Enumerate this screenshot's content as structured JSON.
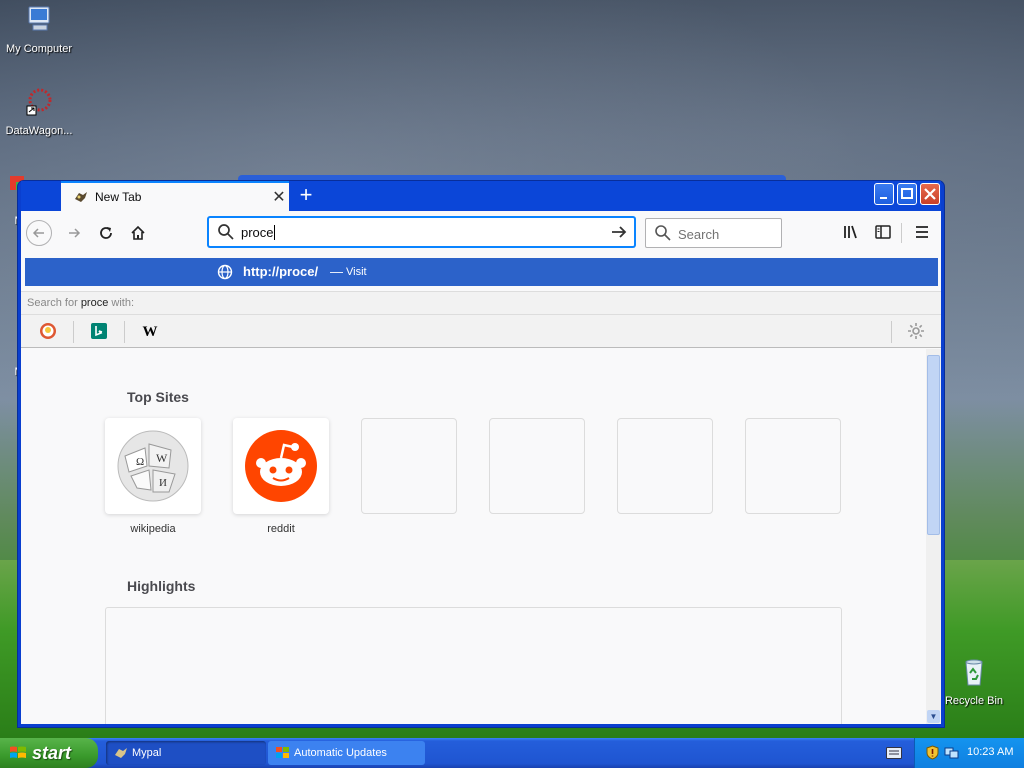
{
  "desktop": {
    "icons": [
      {
        "label": "My Computer"
      },
      {
        "label": "DataWagon..."
      },
      {
        "label": "Mic"
      },
      {
        "label": "Mic"
      },
      {
        "label": "Recycle Bin"
      }
    ]
  },
  "browser": {
    "tab": {
      "title": "New Tab",
      "close": "✕"
    },
    "new_tab_symbol": "+",
    "caption": {
      "minimize": "_",
      "maximize": "□",
      "close": "✕"
    },
    "urlbar": {
      "value": "proce"
    },
    "searchbar": {
      "placeholder": "Search"
    },
    "suggestion": {
      "url": "http://proce/",
      "dash": "—",
      "action": "Visit"
    },
    "oneoff": {
      "prefix": "Search for",
      "term": "proce",
      "suffix": "with:"
    },
    "engines": [
      {
        "name": "DuckDuckGo",
        "icon": "duckduckgo-icon"
      },
      {
        "name": "Bing",
        "icon": "bing-icon"
      },
      {
        "name": "Wikipedia",
        "icon": "wikipedia-icon",
        "glyph": "W"
      }
    ],
    "newtab": {
      "top_sites_title": "Top Sites",
      "top_sites": [
        {
          "label": "wikipedia",
          "icon": "wikipedia-globe-icon"
        },
        {
          "label": "reddit",
          "icon": "reddit-icon"
        },
        {
          "label": "",
          "icon": ""
        },
        {
          "label": "",
          "icon": ""
        },
        {
          "label": "",
          "icon": ""
        },
        {
          "label": "",
          "icon": ""
        }
      ],
      "highlights_title": "Highlights"
    }
  },
  "taskbar": {
    "start_label": "start",
    "tasks": [
      {
        "label": "Mypal",
        "active": true
      },
      {
        "label": "Automatic Updates",
        "active": false
      }
    ],
    "clock": "10:23 AM"
  },
  "colors": {
    "accent": "#0a84ff",
    "suggestion_bg": "#2c62c9",
    "reddit": "#ff4500",
    "titlebar": "#0b46d8"
  }
}
